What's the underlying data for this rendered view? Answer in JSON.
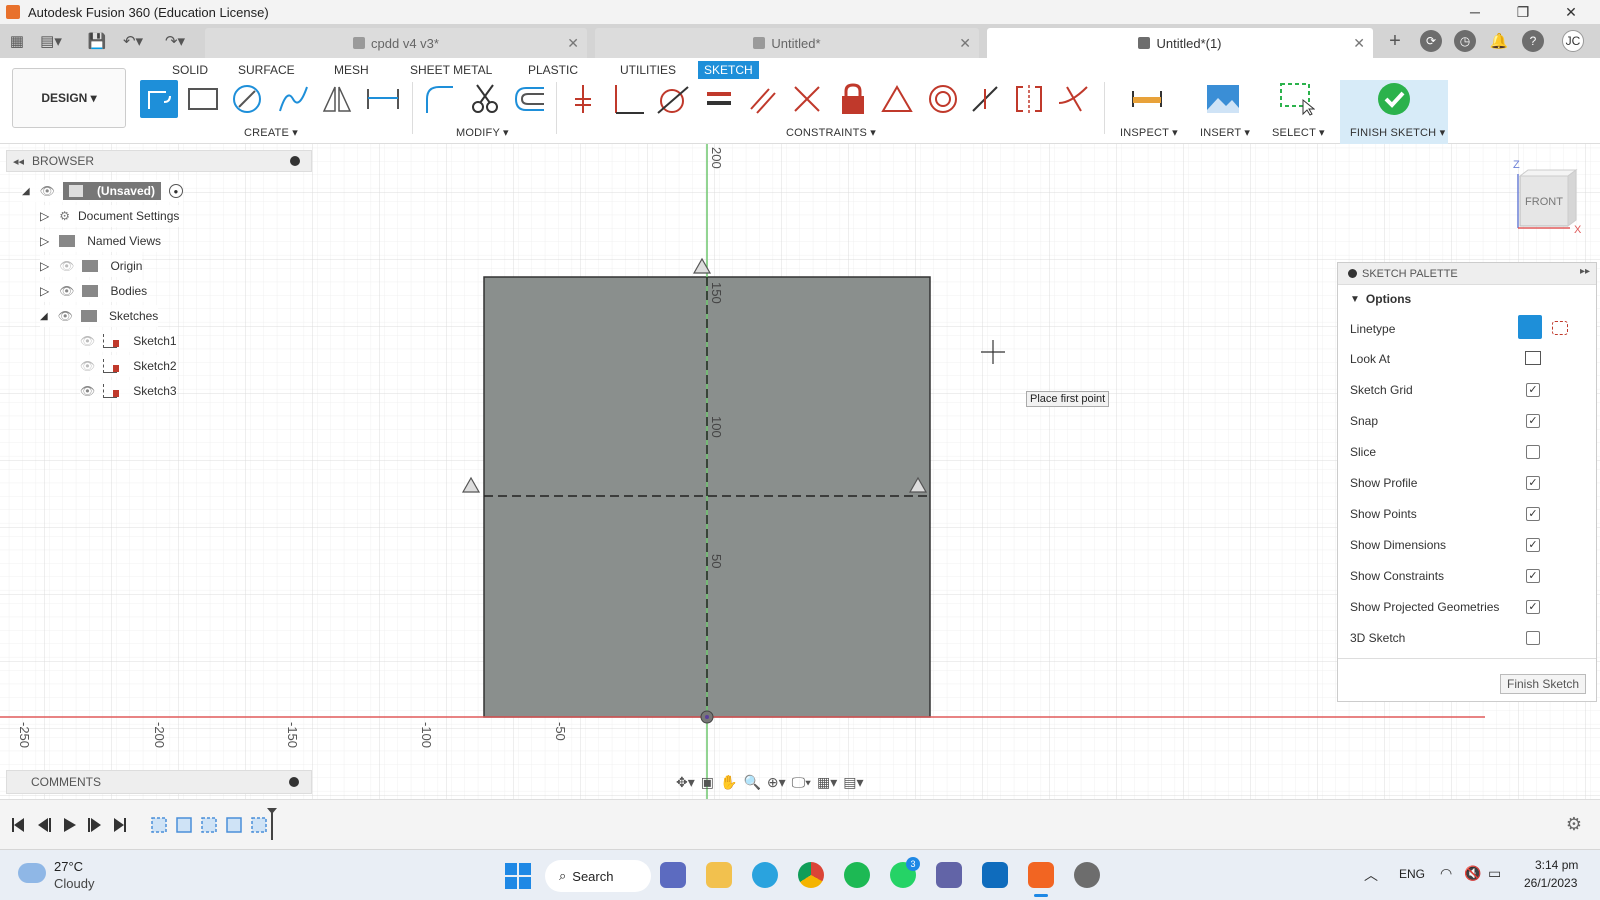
{
  "app": {
    "title": "Autodesk Fusion 360 (Education License)"
  },
  "window_controls": {
    "minimize": "─",
    "restore": "❐",
    "close": "✕"
  },
  "doc_tabs": [
    {
      "label": "cpdd v4 v3*",
      "active": false
    },
    {
      "label": "Untitled*",
      "active": false
    },
    {
      "label": "Untitled*(1)",
      "active": true
    }
  ],
  "account": {
    "initials": "JC"
  },
  "toolbar": {
    "tabs": [
      "SOLID",
      "SURFACE",
      "MESH",
      "SHEET METAL",
      "PLASTIC",
      "UTILITIES",
      "SKETCH"
    ],
    "active_tab": "SKETCH",
    "design_label": "DESIGN ▾",
    "groups": {
      "create": "CREATE ▾",
      "modify": "MODIFY ▾",
      "constraints": "CONSTRAINTS ▾",
      "inspect": "INSPECT ▾",
      "insert": "INSERT ▾",
      "select": "SELECT ▾",
      "finish": "FINISH SKETCH ▾"
    }
  },
  "browser": {
    "title": "BROWSER",
    "root": "(Unsaved)",
    "items": [
      "Document Settings",
      "Named Views",
      "Origin",
      "Bodies",
      "Sketches"
    ],
    "sketches": [
      "Sketch1",
      "Sketch2",
      "Sketch3"
    ]
  },
  "viewport": {
    "tooltip": "Place first point",
    "ruler_y": [
      "200",
      "150",
      "100",
      "50"
    ],
    "ruler_x": [
      "-250",
      "-200",
      "-150",
      "-100",
      "-50"
    ],
    "viewcube": {
      "face": "FRONT",
      "z": "Z",
      "x": "X"
    }
  },
  "palette": {
    "title": "SKETCH PALETTE",
    "section": "Options",
    "linetype": "Linetype",
    "look_at": "Look At",
    "options": [
      {
        "label": "Sketch Grid",
        "checked": true
      },
      {
        "label": "Snap",
        "checked": true
      },
      {
        "label": "Slice",
        "checked": false
      },
      {
        "label": "Show Profile",
        "checked": true
      },
      {
        "label": "Show Points",
        "checked": true
      },
      {
        "label": "Show Dimensions",
        "checked": true
      },
      {
        "label": "Show Constraints",
        "checked": true
      },
      {
        "label": "Show Projected Geometries",
        "checked": true
      },
      {
        "label": "3D Sketch",
        "checked": false
      }
    ],
    "finish_button": "Finish Sketch"
  },
  "comments": {
    "title": "COMMENTS"
  },
  "taskbar": {
    "weather_temp": "27°C",
    "weather_desc": "Cloudy",
    "search": "Search",
    "lang": "ENG",
    "time": "3:14 pm",
    "date": "26/1/2023",
    "whatsapp_badge": "3"
  }
}
